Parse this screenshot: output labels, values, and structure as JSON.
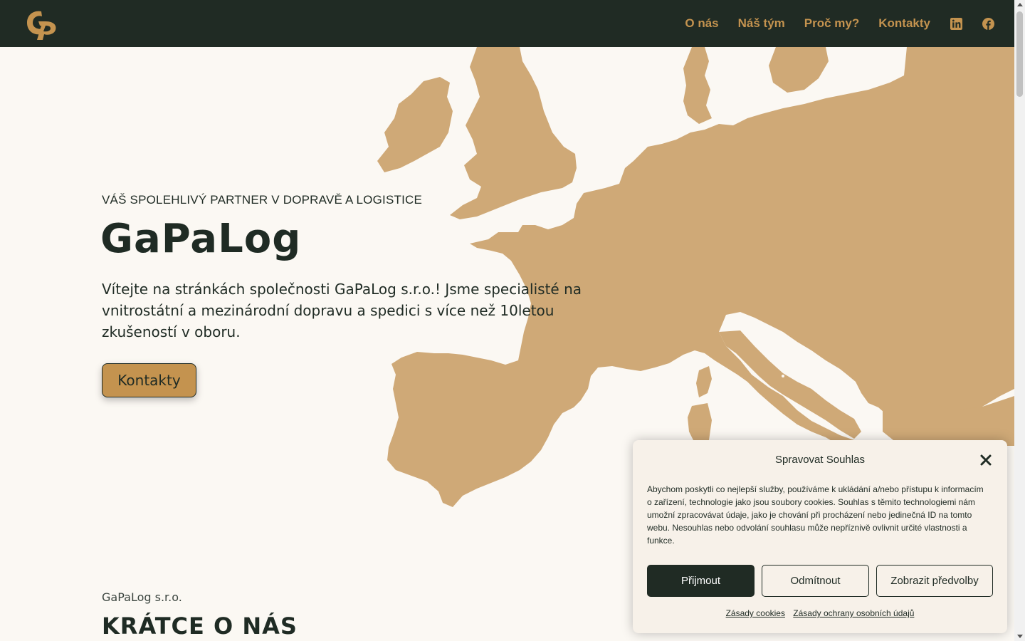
{
  "nav": {
    "logo_alt": "GP",
    "links": [
      "O nás",
      "Náš tým",
      "Proč my?",
      "Kontakty"
    ],
    "icons": [
      "linkedin-icon",
      "facebook-icon"
    ]
  },
  "hero": {
    "tagline": "VÁŠ SPOLEHLIVÝ PARTNER V DOPRAVĚ A LOGISTICE",
    "title": "GaPaLog",
    "text": "Vítejte na stránkách společnosti GaPaLog s.r.o.! Jsme specialisté na vnitrostátní a mezinárodní dopravu a spedici s více než 10letou zkušeností v oboru.",
    "button": "Kontakty"
  },
  "about": {
    "company": "GaPaLog s.r.o.",
    "title": "KRÁTCE O NÁS"
  },
  "consent": {
    "title": "Spravovat Souhlas",
    "text": "Abychom poskytli co nejlepší služby, používáme k ukládání a/nebo přístupu k informacím o zařízení, technologie jako jsou soubory cookies. Souhlas s těmito technologiemi nám umožní zpracovávat údaje, jako je chování při procházení nebo jedinečná ID na tomto webu. Nesouhlas nebo odvolání souhlasu může nepříznivě ovlivnit určité vlastnosti a funkce.",
    "accept": "Přijmout",
    "deny": "Odmítnout",
    "prefs": "Zobrazit předvolby",
    "link_cookies": "Zásady cookies",
    "link_privacy": "Zásady ochrany osobních údajů"
  },
  "colors": {
    "nav_bg": "#202b24",
    "accent": "#c4934f",
    "map": "#cfa977",
    "page_bg": "#fbf8f3"
  }
}
